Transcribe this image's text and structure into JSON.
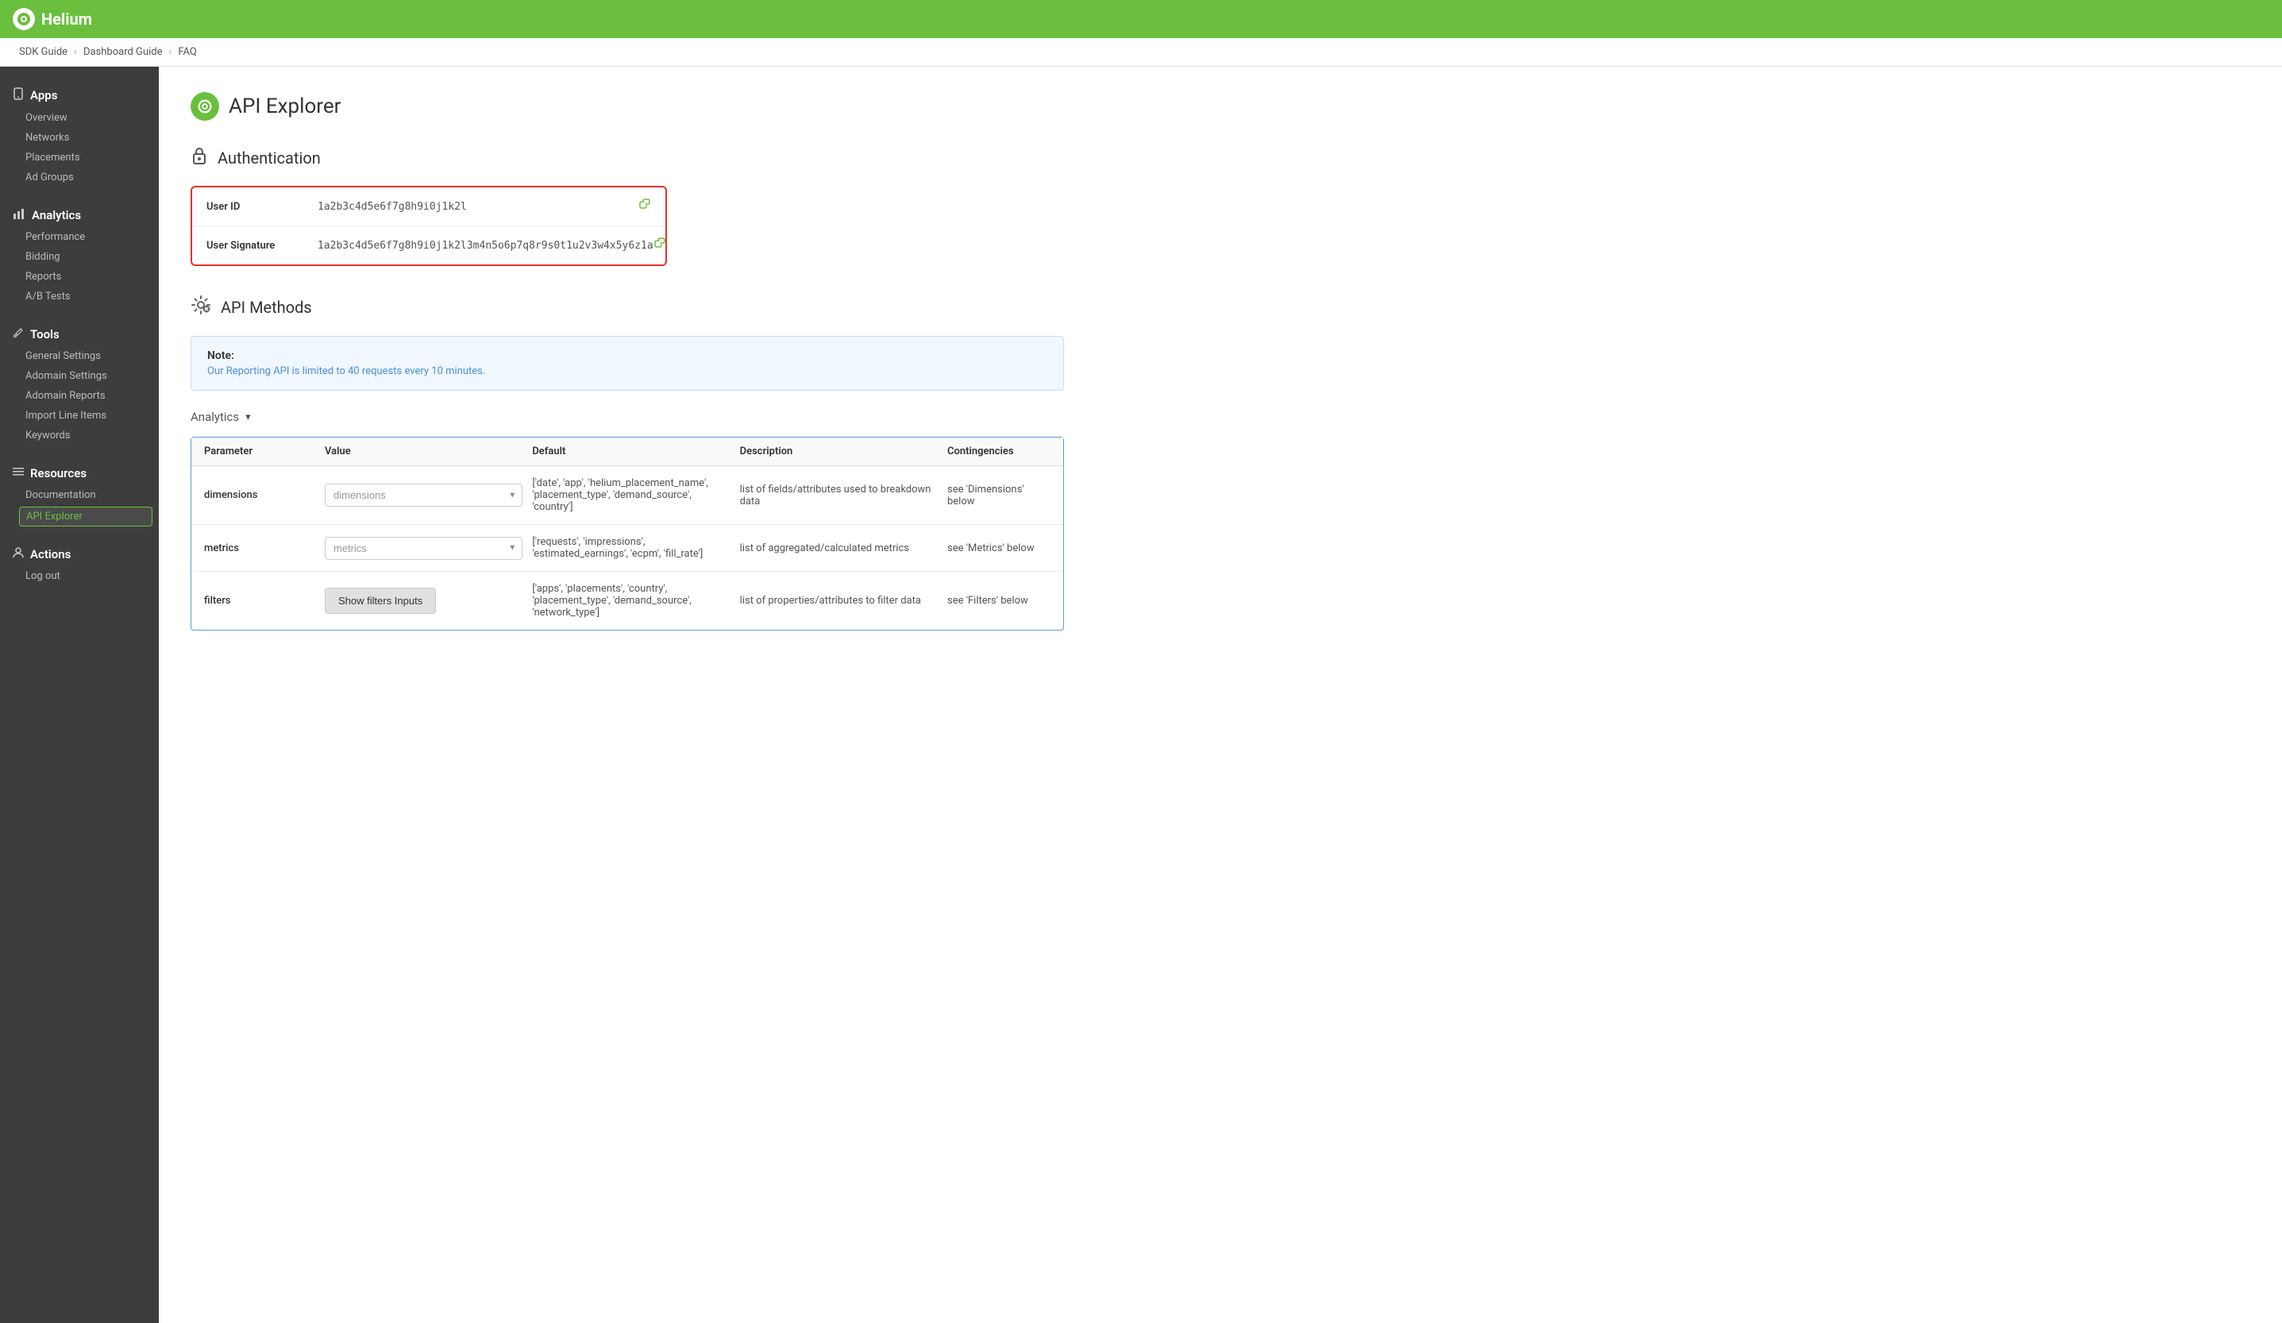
{
  "topbar": {
    "logo_text": "Helium",
    "logo_alt": "Helium logo"
  },
  "breadcrumb": {
    "items": [
      "SDK Guide",
      "Dashboard Guide",
      "FAQ"
    ],
    "separators": [
      ">",
      ">"
    ]
  },
  "sidebar": {
    "sections": [
      {
        "id": "apps",
        "icon": "📱",
        "label": "Apps",
        "items": [
          "Overview",
          "Networks",
          "Placements",
          "Ad Groups"
        ]
      },
      {
        "id": "analytics",
        "icon": "📊",
        "label": "Analytics",
        "items": [
          "Performance",
          "Bidding",
          "Reports",
          "A/B Tests"
        ]
      },
      {
        "id": "tools",
        "icon": "🔧",
        "label": "Tools",
        "items": [
          "General Settings",
          "Adomain Settings",
          "Adomain Reports",
          "Import Line Items",
          "Keywords"
        ]
      },
      {
        "id": "resources",
        "icon": "☰",
        "label": "Resources",
        "items": [
          "Documentation",
          "API Explorer"
        ]
      },
      {
        "id": "actions",
        "icon": "👤",
        "label": "Actions",
        "items": [
          "Log out"
        ]
      }
    ],
    "active_item": "API Explorer"
  },
  "page": {
    "header_icon": "🔵",
    "title": "API Explorer",
    "auth_section": {
      "heading": "Authentication",
      "icon": "🔒",
      "rows": [
        {
          "label": "User ID",
          "value": "1a2b3c4d5e6f7g8h9i0j1k2l"
        },
        {
          "label": "User Signature",
          "value": "1a2b3c4d5e6f7g8h9i0j1k2l3m4n5o6p7q8r9s0t1u2v3w4x5y6z1a"
        }
      ]
    },
    "api_methods_section": {
      "heading": "API Methods",
      "icon": "⚙️",
      "note": {
        "title": "Note:",
        "text": "Our Reporting API is limited to 40 requests every 10 minutes."
      },
      "analytics_label": "Analytics",
      "table": {
        "headers": [
          "Parameter",
          "Value",
          "Default",
          "Description",
          "Contingencies"
        ],
        "rows": [
          {
            "parameter": "dimensions",
            "value_placeholder": "dimensions",
            "default": "['date', 'app', 'helium_placement_name', 'placement_type', 'demand_source', 'country']",
            "description": "list of fields/attributes used to breakdown data",
            "contingencies": "see 'Dimensions' below"
          },
          {
            "parameter": "metrics",
            "value_placeholder": "metrics",
            "default": "['requests', 'impressions', 'estimated_earnings', 'ecpm', 'fill_rate']",
            "description": "list of aggregated/calculated metrics",
            "contingencies": "see 'Metrics' below"
          },
          {
            "parameter": "filters",
            "value_button": "Show filters Inputs",
            "default": "['apps', 'placements', 'country', 'placement_type', 'demand_source', 'network_type']",
            "description": "list of properties/attributes to filter data",
            "contingencies": "see 'Filters' below"
          }
        ]
      }
    }
  }
}
